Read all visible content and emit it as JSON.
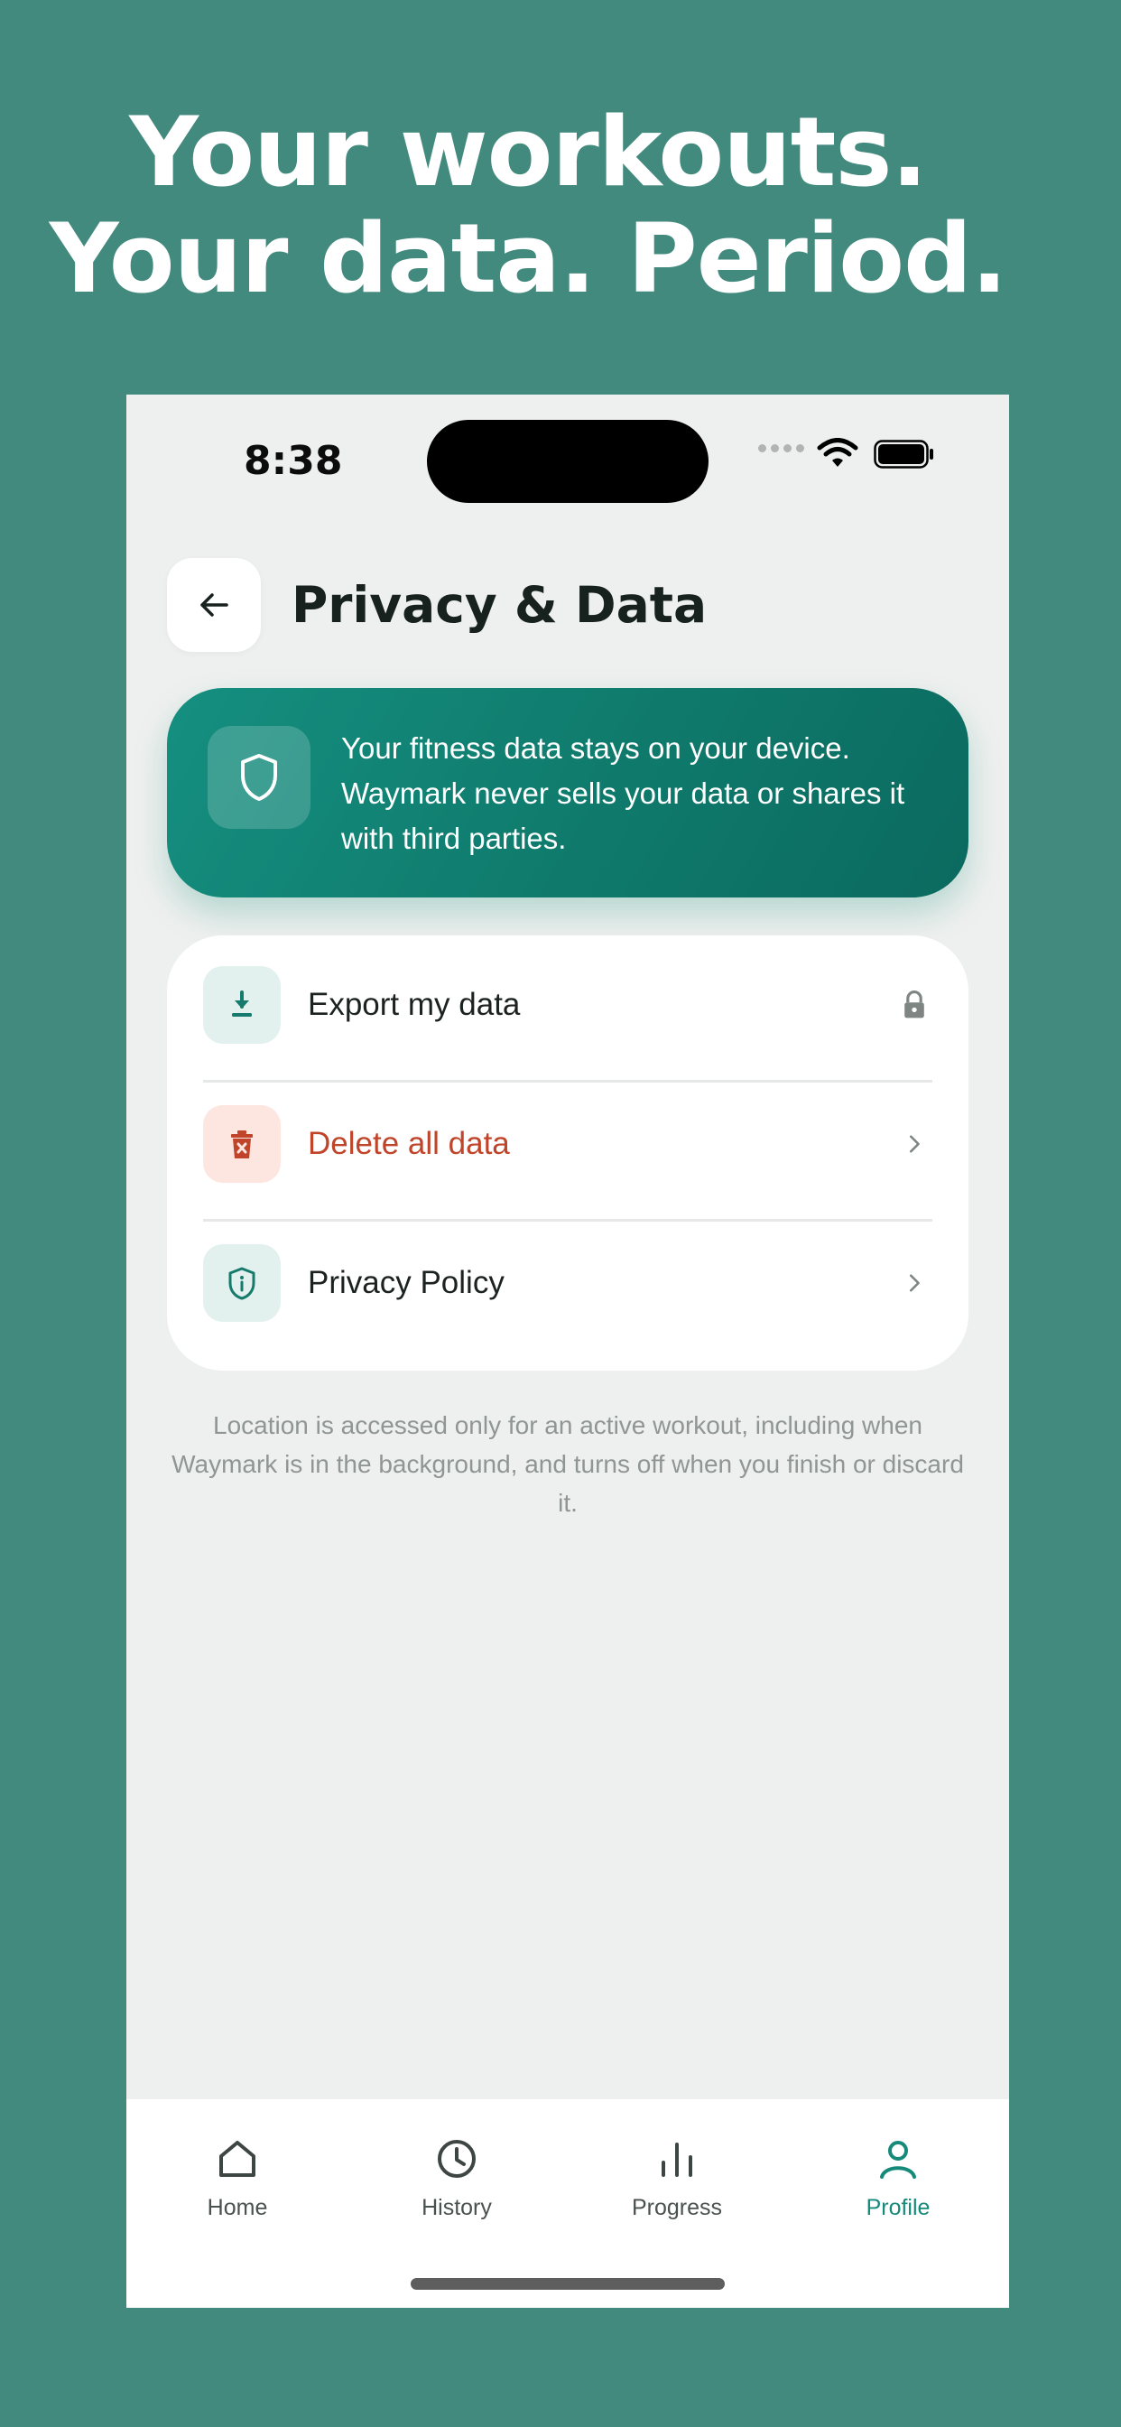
{
  "headline": "Your workouts. Your data. Period.",
  "status_bar": {
    "time": "8:38"
  },
  "header": {
    "title": "Privacy & Data"
  },
  "banner": {
    "text": "Your fitness data stays on your device. Waymark never sells your data or shares it with third parties."
  },
  "settings": {
    "items": [
      {
        "label": "Export my data",
        "icon": "download-icon",
        "trailing": "lock-icon"
      },
      {
        "label": "Delete all data",
        "icon": "trash-icon",
        "trailing": "chevron-right-icon"
      },
      {
        "label": "Privacy Policy",
        "icon": "shield-info-icon",
        "trailing": "chevron-right-icon"
      }
    ]
  },
  "footnote": "Location is accessed only for an active workout, including when Waymark is in the background, and turns off when you finish or discard it.",
  "tabbar": {
    "tabs": [
      {
        "label": "Home",
        "icon": "home-icon"
      },
      {
        "label": "History",
        "icon": "clock-icon"
      },
      {
        "label": "Progress",
        "icon": "bar-chart-icon"
      },
      {
        "label": "Profile",
        "icon": "person-icon",
        "active": true
      }
    ]
  },
  "colors": {
    "background": "#438a7e",
    "accent": "#168a7a",
    "danger": "#c0442a"
  }
}
